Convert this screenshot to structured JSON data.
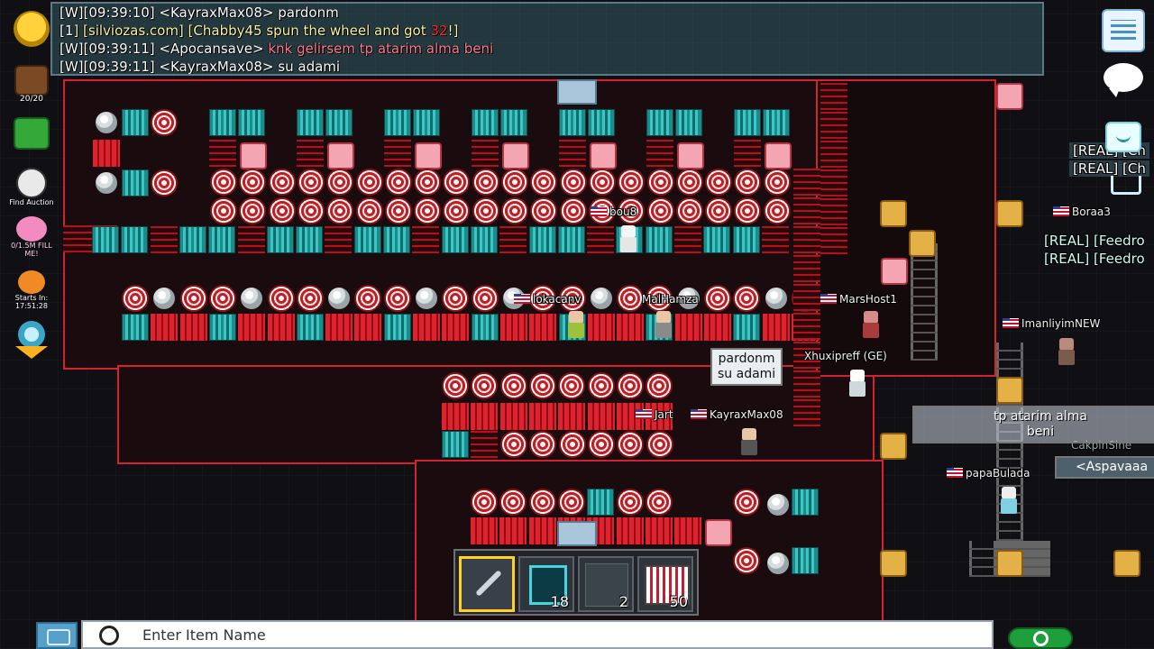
{
  "chat": {
    "lines": [
      {
        "parts": [
          {
            "text": "[W][09:39:10] ",
            "color": "white"
          },
          {
            "text": "<KayraxMax08> ",
            "color": "white"
          },
          {
            "text": "pardonm",
            "color": "white"
          }
        ]
      },
      {
        "parts": [
          {
            "text": "[",
            "color": "white"
          },
          {
            "text": "1",
            "color": "white"
          },
          {
            "text": "] [silviozas.com] [Chabby45 spun the wheel and got ",
            "color": "yellow"
          },
          {
            "text": "32",
            "color": "red"
          },
          {
            "text": "!]",
            "color": "yellow"
          }
        ]
      },
      {
        "parts": [
          {
            "text": "[W][09:39:11] ",
            "color": "white"
          },
          {
            "text": "<Apocansave> ",
            "color": "white"
          },
          {
            "text": "knk gelirsem tp atarim alma beni",
            "color": "pink"
          }
        ]
      },
      {
        "parts": [
          {
            "text": "[W][09:39:11] ",
            "color": "white"
          },
          {
            "text": "<KayraxMax08> ",
            "color": "white"
          },
          {
            "text": "su adami",
            "color": "white"
          }
        ]
      }
    ]
  },
  "left_hud": {
    "backpack_count": "20/20",
    "auction_label": "Find Auction",
    "pig_label": "0/1.5M FILL ME!",
    "event_label": "Starts In: 17:51:28"
  },
  "players": [
    {
      "name": "bou8"
    },
    {
      "name": "lokacanv"
    },
    {
      "name": "MalHamza"
    },
    {
      "name": "MarsHost1"
    },
    {
      "name": "Xhuxipreff (GE)"
    },
    {
      "name": "Jart"
    },
    {
      "name": "KayraxMax08"
    },
    {
      "name": "Boraa3"
    },
    {
      "name": "ImanliyimNEW"
    },
    {
      "name": "papaBulada"
    },
    {
      "name": "CakpinSine"
    },
    {
      "name": "Aspavaaa"
    }
  ],
  "bubbles": {
    "kayrax": "pardonm\nsu adami",
    "apocan": "tp atarim alma\nbeni",
    "aspa": "<Aspavaaa"
  },
  "signs": {
    "top_right_1": "[REAL] [Ch",
    "top_right_2": "[REAL] [Ch",
    "mid_right_1": "[REAL] [Feedro",
    "mid_right_2": "[REAL] [Feedro"
  },
  "toolbar": {
    "slots": [
      {
        "item": "wrench-icon",
        "count": ""
      },
      {
        "item": "portal-icon",
        "count": "18"
      },
      {
        "item": "dark-block-icon",
        "count": "2"
      },
      {
        "item": "spike-trap-icon",
        "count": "50"
      }
    ]
  },
  "search": {
    "placeholder": "Enter Item Name"
  },
  "colors": {
    "world_red": "#d4232f",
    "glass": "#38c7c4",
    "chat_pink": "#ff7a8f",
    "chat_yellow": "#f8f3a0",
    "chat_red": "#ff2b2b"
  }
}
